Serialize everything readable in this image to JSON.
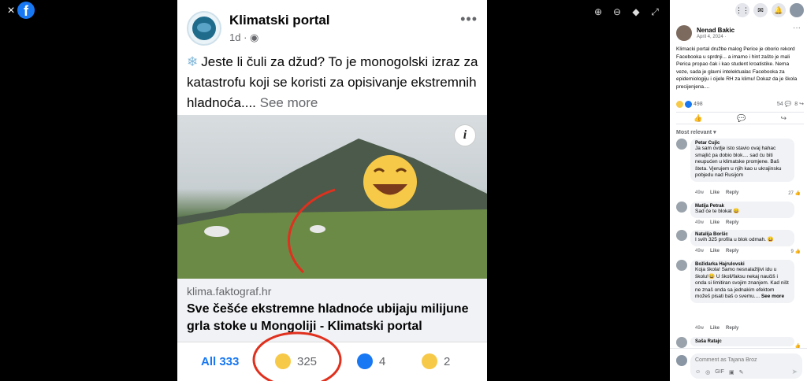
{
  "viewer": {
    "close_icon": "×",
    "logo_letter": "f",
    "tools": [
      "⊕",
      "⊖",
      "◆",
      "⤢"
    ]
  },
  "post": {
    "page_name": "Klimatski portal",
    "time": "1d · ",
    "globe_icon": "◉",
    "more": "•••",
    "snow_icon": "❄",
    "text": "Jeste li čuli za džud? To je monogolski izraz za katastrofu koji se koristi za opisivanje ekstremnih hladnoća.... ",
    "see_more": "See more",
    "info_icon": "i",
    "link_domain": "klima.faktograf.hr",
    "link_title": "Sve češće ekstremne hladnoće ubijaju milijune grla stoke u Mongoliji - Klimatski portal",
    "reactions": {
      "all_label": "All 333",
      "haha_count": "325",
      "like_count": "4",
      "sad_count": "2"
    }
  },
  "sidebar": {
    "top_icons": [
      "⋮⋮",
      "✉",
      "🔔"
    ],
    "author_name": "Nenad Bakic",
    "author_date": "April 4, 2024 · ",
    "more": "···",
    "text": "Klimacki portal družbe malog Perice je oborio rekord Facebooka u sprdnji... a imamo i hint zašto je mali Perica propao čak i kao student kroatistike. Nema veze, sada je glavni intelektualac Facebooka za epidemiologiju i cijele RH za klimu! Dokaz da je škola precijenjena....",
    "reaction_count": "498",
    "comment_count": "54 💬",
    "share_count": "8 ↪",
    "actions": [
      "👍",
      "💬",
      "↪"
    ],
    "sort_label": "Most relevant ▾",
    "comments": [
      {
        "name": "Petar Cujic",
        "text": "Ja sam ovdje isto stavio ovaj hahac smajlić pa dobio blok.... sad ću biti neupućen u klimatske promjene. Baš šteta. Vjerujem u njih kao u ukrajinsku pobjedu nad Rusijom",
        "time": "49w",
        "like": "Like",
        "reply": "Reply",
        "count": "27 👍"
      },
      {
        "name": "Matija Petrak",
        "text": "Sad će te blokat 😄",
        "time": "49w",
        "like": "Like",
        "reply": "Reply",
        "count": ""
      },
      {
        "name": "Natalija Boršic",
        "text": "I svih 325 profila u blok odmah. 😄",
        "time": "49w",
        "like": "Like",
        "reply": "Reply",
        "count": "9 👍"
      },
      {
        "name": "Božidarka Hajrulovski",
        "text": "Koja škola! Samo nesnalažljivi idu u školu!😄 U školi/faksu nekaj naučiš i onda si limitiran svojim znanjem. Kad ništ ne znaš onda sa jednakim efektom možeš pisati baš o svemu.... ",
        "see_more": "See more",
        "time": "49w",
        "like": "Like",
        "reply": "Reply",
        "count": ""
      },
      {
        "name": "Saša Ratajc",
        "text": "",
        "time": "",
        "like": "",
        "reply": "",
        "count": "👍"
      }
    ],
    "composer_placeholder": "Comment as Tajana Broz",
    "composer_tools": [
      "☺",
      "◎",
      "GIF",
      "▣",
      "✎"
    ],
    "send_icon": "➤"
  }
}
